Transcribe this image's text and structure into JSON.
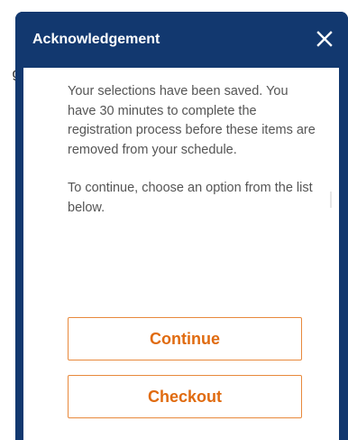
{
  "background": {
    "peek_text": "g"
  },
  "dialog": {
    "title": "Acknowledgement",
    "close_icon": "close-icon",
    "message_paragraphs": [
      "Your selections have been saved. You have 30 minutes to complete the registration process before these items are removed from your schedule.",
      "To continue, choose an option from the list below."
    ],
    "buttons": {
      "continue_label": "Continue",
      "checkout_label": "Checkout"
    }
  },
  "colors": {
    "header_bg": "#12386f",
    "header_text": "#ffffff",
    "body_text": "#555555",
    "button_text": "#e06b10",
    "button_border": "#e8893c"
  }
}
